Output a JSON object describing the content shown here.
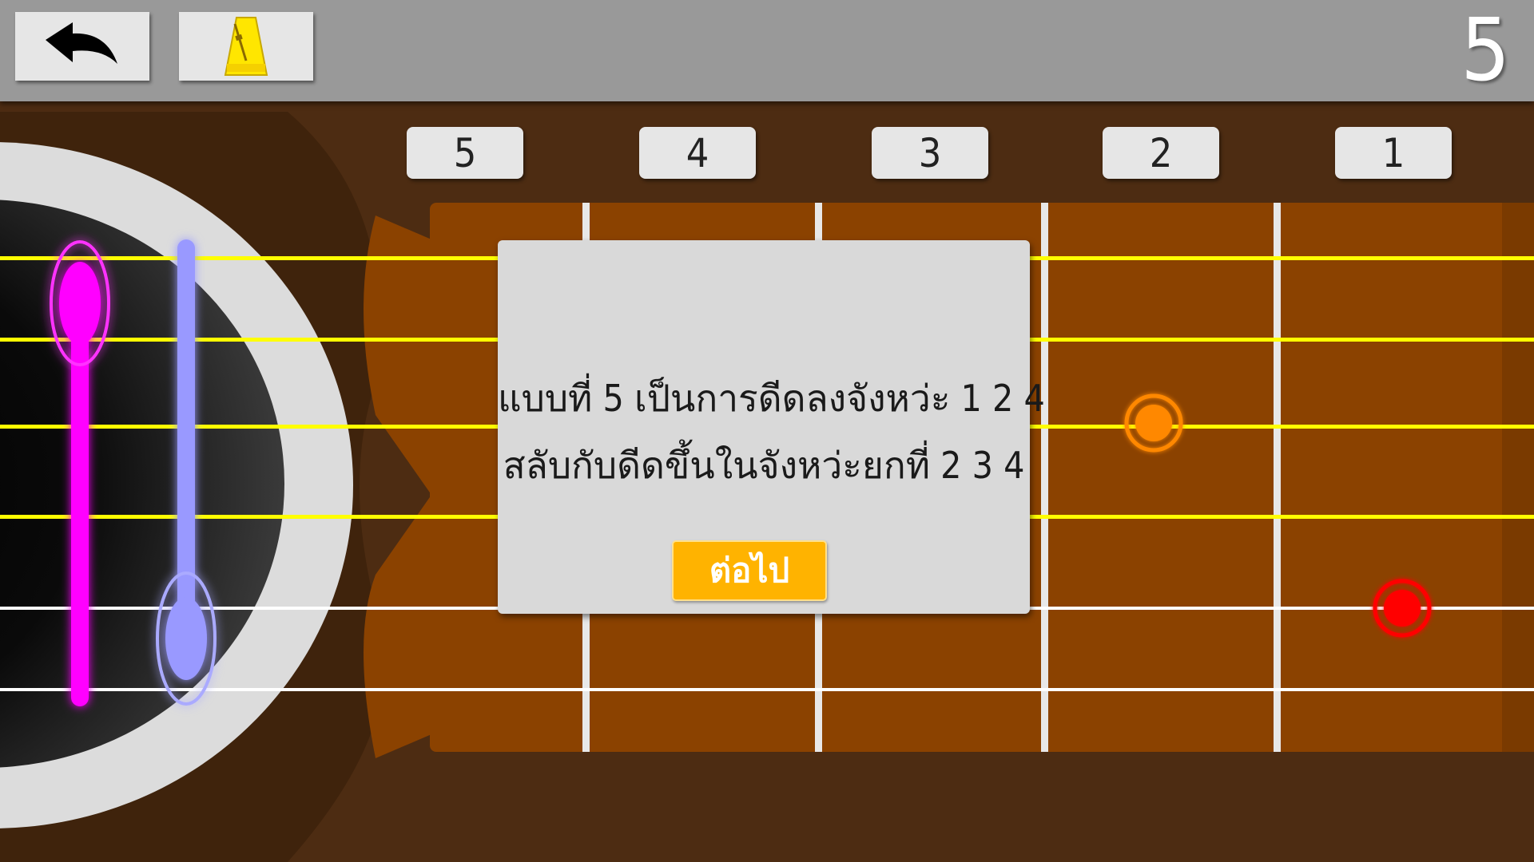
{
  "header": {
    "back_icon": "undo-arrow-icon",
    "metronome_icon": "metronome-icon",
    "level": "5"
  },
  "fret_tabs": [
    "5",
    "4",
    "3",
    "2",
    "1"
  ],
  "dialog": {
    "line1": "แบบที่ 5 เป็นการดีดลงจังหว่ะ 1 2 4",
    "line2": "สลับกับดีดขึ้นในจังหว่ะยกที่ 2 3 4",
    "next_label": "ต่อไป"
  },
  "colors": {
    "topbar": "#999999",
    "background": "#4d2c12",
    "fretboard": "#8b4200",
    "string_top": "#ffff00",
    "string_bottom": "#ffffff",
    "pick_down": "#ff00ff",
    "pick_up": "#9999ff",
    "note_orange": "#ff8800",
    "note_red": "#ff0000",
    "button": "#ffb300"
  }
}
